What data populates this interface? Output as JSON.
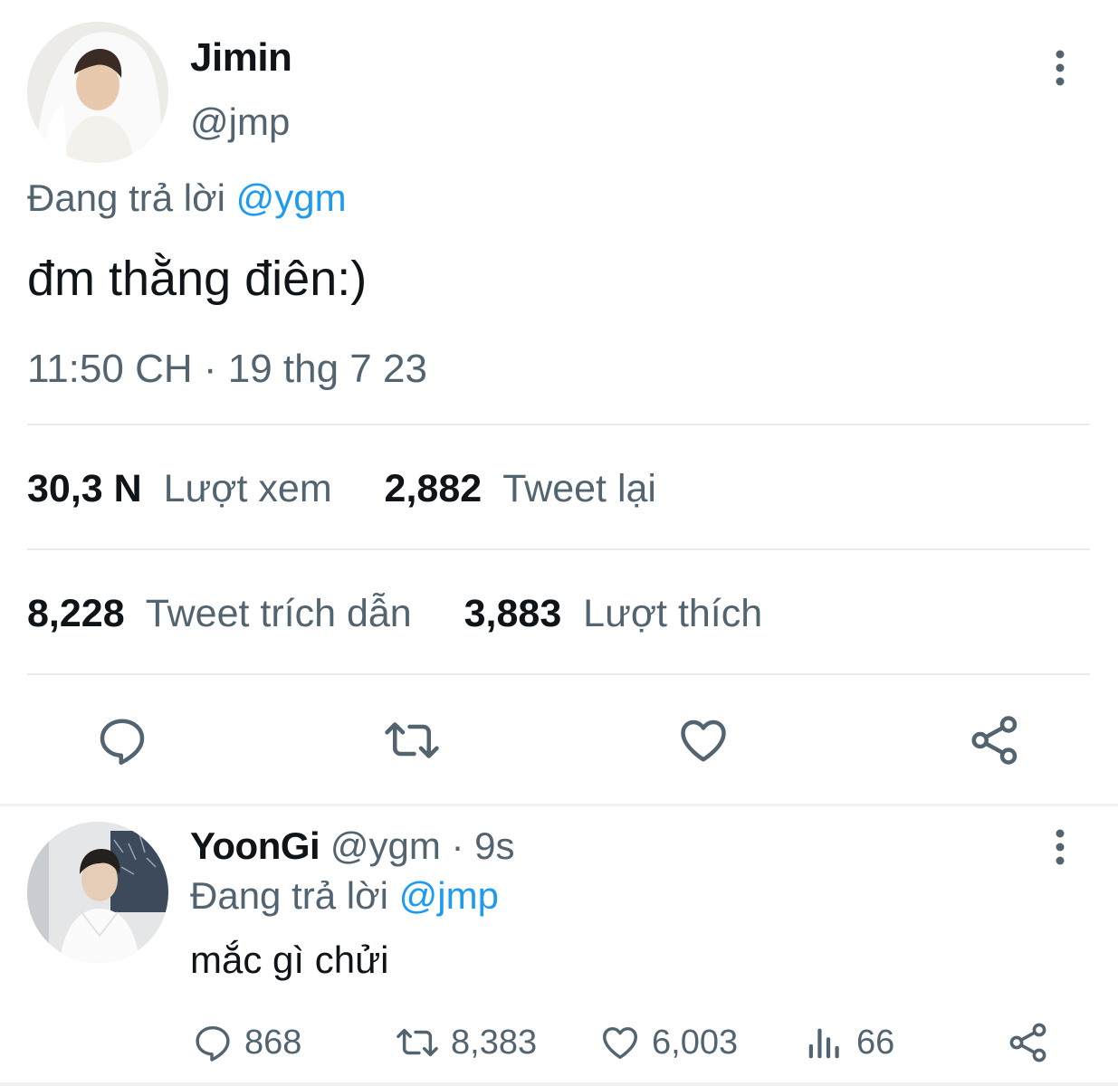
{
  "main_tweet": {
    "author": {
      "display_name": "Jimin",
      "handle": "@jmp"
    },
    "replying_prefix": "Đang trả lời",
    "replying_to": "@ygm",
    "text": "đm thằng điên:)",
    "timestamp": "11:50 CH · 19 thg 7 23",
    "stats": {
      "views": {
        "value": "30,3 N",
        "label": "Lượt xem"
      },
      "retweets": {
        "value": "2,882",
        "label": "Tweet lại"
      },
      "quotes": {
        "value": "8,228",
        "label": "Tweet trích dẫn"
      },
      "likes": {
        "value": "3,883",
        "label": "Lượt thích"
      }
    },
    "actions": [
      "reply-icon",
      "retweet-icon",
      "like-icon",
      "share-icon"
    ]
  },
  "reply_tweet": {
    "author": {
      "display_name": "YoonGi",
      "handle": "@ygm",
      "time_ago": "· 9s"
    },
    "replying_prefix": "Đang trả lời",
    "replying_to": "@jmp",
    "text": "mắc gì chửi",
    "counts": {
      "replies": "868",
      "retweets": "8,383",
      "likes": "6,003",
      "views": "66"
    }
  },
  "colors": {
    "text_primary": "#0f1419",
    "text_secondary": "#536471",
    "accent": "#1d9bf0",
    "divider": "#e6ecf0"
  }
}
